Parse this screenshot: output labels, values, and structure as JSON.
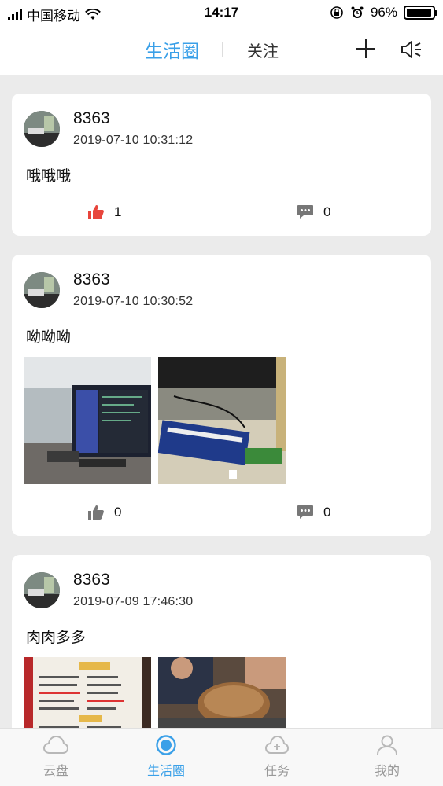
{
  "status_bar": {
    "carrier": "中国移动",
    "time": "14:17",
    "battery": "96%",
    "battery_level": 0.96
  },
  "header": {
    "tab_active": "生活圈",
    "tab_follow": "关注",
    "add_icon": "plus-icon",
    "speaker_icon": "speaker-icon"
  },
  "posts": [
    {
      "username": "8363",
      "timestamp": "2019-07-10 10:31:12",
      "text": "哦哦哦",
      "likes": "1",
      "liked": true,
      "comments": "0",
      "photos": []
    },
    {
      "username": "8363",
      "timestamp": "2019-07-10 10:30:52",
      "text": "呦呦呦",
      "likes": "0",
      "liked": false,
      "comments": "0",
      "photos": [
        "office-monitor-photo",
        "desk-hardware-photo"
      ]
    },
    {
      "username": "8363",
      "timestamp": "2019-07-09 17:46:30",
      "text": "肉肉多多",
      "photos": [
        "menu-photo",
        "roast-meat-photo"
      ]
    }
  ],
  "tab_bar": {
    "items": [
      {
        "label": "云盘",
        "icon": "cloud-icon"
      },
      {
        "label": "生活圈",
        "icon": "circle-icon"
      },
      {
        "label": "任务",
        "icon": "cloud-task-icon"
      },
      {
        "label": "我的",
        "icon": "user-icon"
      }
    ],
    "active_index": 1
  },
  "colors": {
    "accent": "#3aa0e8",
    "like_active": "#e8453c",
    "icon_gray": "#777777",
    "background": "#ebebeb"
  }
}
